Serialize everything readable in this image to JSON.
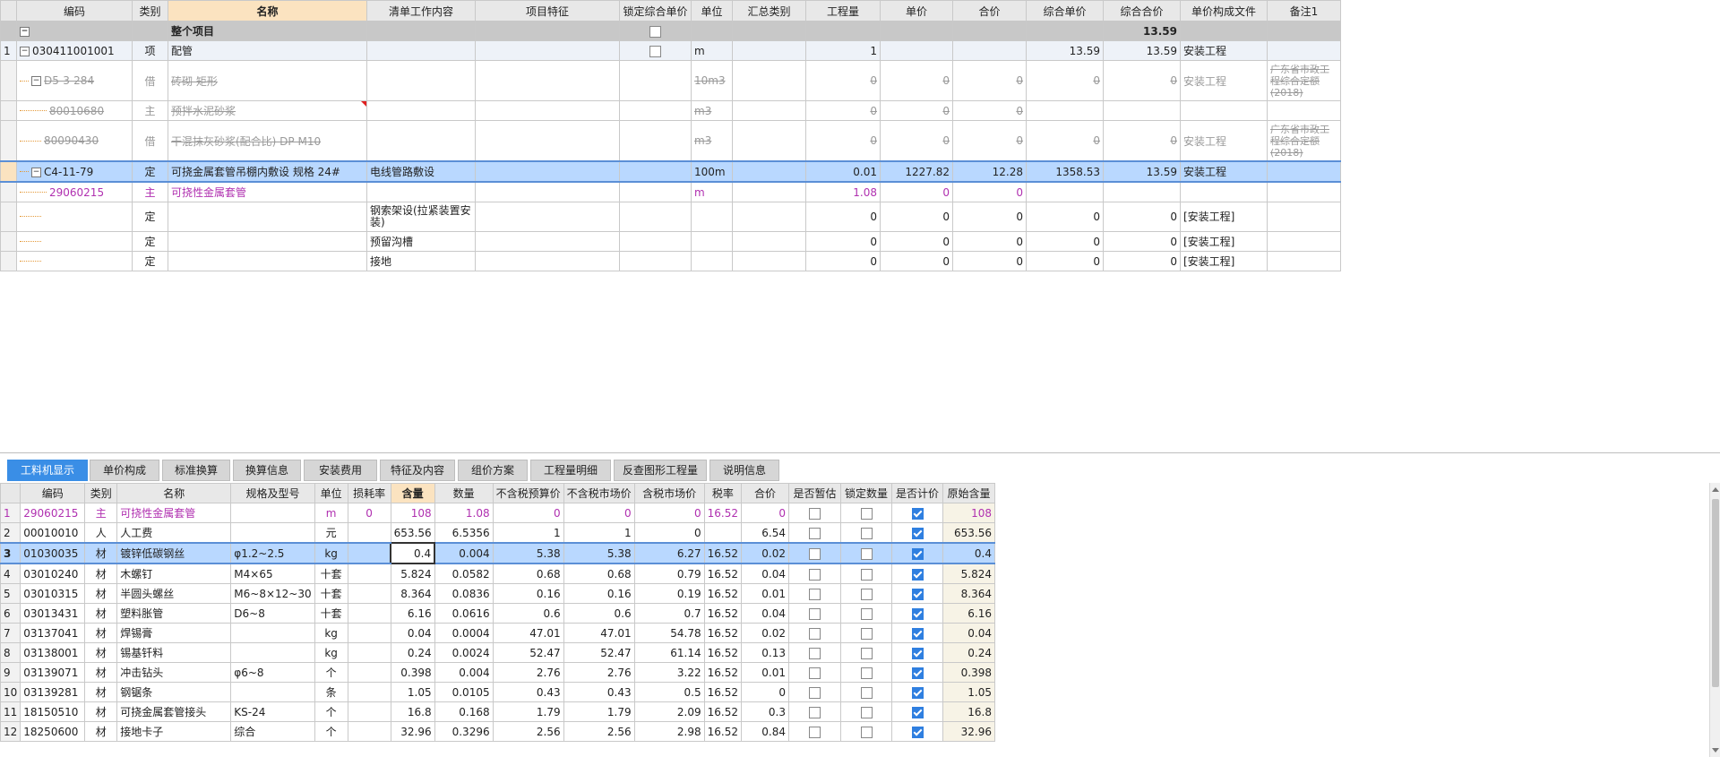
{
  "top": {
    "headers": [
      "编码",
      "类别",
      "名称",
      "清单工作内容",
      "项目特征",
      "锁定综合单价",
      "单位",
      "汇总类别",
      "工程量",
      "单价",
      "合价",
      "综合单价",
      "综合合价",
      "单价构成文件",
      "备注1"
    ],
    "summary": {
      "name": "整个项目",
      "total": "13.59"
    },
    "parent": {
      "no": "1",
      "code": "030411001001",
      "type": "项",
      "name": "配管",
      "unit": "m",
      "qty": "1",
      "unit_total": "13.59",
      "total": "13.59",
      "file": "安装工程"
    },
    "faded": [
      {
        "code": "D5-3-284",
        "type": "借",
        "name": "砖砌 矩形",
        "unit": "10m3",
        "qty": "0",
        "price": "0",
        "amount": "0",
        "unit_total": "0",
        "total": "0",
        "file": "安装工程",
        "remark": "广东省市政工程综合定额(2018)"
      },
      {
        "code": "80010680",
        "type": "主",
        "name": "预拌水泥砂浆",
        "unit": "m3",
        "qty": "0",
        "price": "0",
        "amount": "0",
        "unit_total": "",
        "total": "",
        "file": "",
        "remark": ""
      },
      {
        "code": "80090430",
        "type": "借",
        "name": "干混抹灰砂浆(配合比) DP M10",
        "unit": "m3",
        "qty": "0",
        "price": "0",
        "amount": "0",
        "unit_total": "0",
        "total": "0",
        "file": "安装工程",
        "remark": "广东省市政工程综合定额(2018)"
      }
    ],
    "selected": {
      "code": "C4-11-79",
      "type": "定",
      "name": "可挠金属套管吊棚内敷设 规格 24#",
      "work": "电线管路敷设",
      "unit": "100m",
      "qty": "0.01",
      "price": "1227.82",
      "amount": "12.28",
      "unit_total": "1358.53",
      "total": "13.59",
      "file": "安装工程"
    },
    "main_material": {
      "code": "29060215",
      "type": "主",
      "name": "可挠性金属套管",
      "unit": "m",
      "qty": "1.08",
      "price": "0",
      "amount": "0"
    },
    "subs": [
      {
        "type": "定",
        "work": "钢索架设(拉紧装置安装)",
        "qty": "0",
        "price": "0",
        "amount": "0",
        "unit_total": "0",
        "total": "0",
        "file": "[安装工程]"
      },
      {
        "type": "定",
        "work": "预留沟槽",
        "qty": "0",
        "price": "0",
        "amount": "0",
        "unit_total": "0",
        "total": "0",
        "file": "[安装工程]"
      },
      {
        "type": "定",
        "work": "接地",
        "qty": "0",
        "price": "0",
        "amount": "0",
        "unit_total": "0",
        "total": "0",
        "file": "[安装工程]"
      }
    ]
  },
  "tabs": [
    "工料机显示",
    "单价构成",
    "标准换算",
    "换算信息",
    "安装费用",
    "特征及内容",
    "组价方案",
    "工程量明细",
    "反查图形工程量",
    "说明信息"
  ],
  "bottom": {
    "headers": [
      "编码",
      "类别",
      "名称",
      "规格及型号",
      "单位",
      "损耗率",
      "含量",
      "数量",
      "不含税预算价",
      "不含税市场价",
      "含税市场价",
      "税率",
      "合价",
      "是否暂估",
      "锁定数量",
      "是否计价",
      "原始含量"
    ],
    "rows": [
      {
        "no": "1",
        "code": "29060215",
        "type": "主",
        "name": "可挠性金属套管",
        "spec": "",
        "unit": "m",
        "loss": "0",
        "content": "108",
        "qty": "1.08",
        "pre": "0",
        "mkt": "0",
        "mkt_tax": "0",
        "tax": "16.52",
        "amount": "0",
        "orig": "108"
      },
      {
        "no": "2",
        "code": "00010010",
        "type": "人",
        "name": "人工费",
        "spec": "",
        "unit": "元",
        "loss": "",
        "content": "653.56",
        "qty": "6.5356",
        "pre": "1",
        "mkt": "1",
        "mkt_tax": "0",
        "tax": "",
        "amount": "6.54",
        "orig": "653.56"
      },
      {
        "no": "3",
        "code": "01030035",
        "type": "材",
        "name": "镀锌低碳钢丝",
        "spec": "φ1.2~2.5",
        "unit": "kg",
        "loss": "",
        "content": "0.4",
        "qty": "0.004",
        "pre": "5.38",
        "mkt": "5.38",
        "mkt_tax": "6.27",
        "tax": "16.52",
        "amount": "0.02",
        "orig": "0.4"
      },
      {
        "no": "4",
        "code": "03010240",
        "type": "材",
        "name": "木螺钉",
        "spec": "M4×65",
        "unit": "十套",
        "loss": "",
        "content": "5.824",
        "qty": "0.0582",
        "pre": "0.68",
        "mkt": "0.68",
        "mkt_tax": "0.79",
        "tax": "16.52",
        "amount": "0.04",
        "orig": "5.824"
      },
      {
        "no": "5",
        "code": "03010315",
        "type": "材",
        "name": "半圆头螺丝",
        "spec": "M6~8×12~30",
        "unit": "十套",
        "loss": "",
        "content": "8.364",
        "qty": "0.0836",
        "pre": "0.16",
        "mkt": "0.16",
        "mkt_tax": "0.19",
        "tax": "16.52",
        "amount": "0.01",
        "orig": "8.364"
      },
      {
        "no": "6",
        "code": "03013431",
        "type": "材",
        "name": "塑料胀管",
        "spec": "D6~8",
        "unit": "十套",
        "loss": "",
        "content": "6.16",
        "qty": "0.0616",
        "pre": "0.6",
        "mkt": "0.6",
        "mkt_tax": "0.7",
        "tax": "16.52",
        "amount": "0.04",
        "orig": "6.16"
      },
      {
        "no": "7",
        "code": "03137041",
        "type": "材",
        "name": "焊锡膏",
        "spec": "",
        "unit": "kg",
        "loss": "",
        "content": "0.04",
        "qty": "0.0004",
        "pre": "47.01",
        "mkt": "47.01",
        "mkt_tax": "54.78",
        "tax": "16.52",
        "amount": "0.02",
        "orig": "0.04"
      },
      {
        "no": "8",
        "code": "03138001",
        "type": "材",
        "name": "锡基钎料",
        "spec": "",
        "unit": "kg",
        "loss": "",
        "content": "0.24",
        "qty": "0.0024",
        "pre": "52.47",
        "mkt": "52.47",
        "mkt_tax": "61.14",
        "tax": "16.52",
        "amount": "0.13",
        "orig": "0.24"
      },
      {
        "no": "9",
        "code": "03139071",
        "type": "材",
        "name": "冲击钻头",
        "spec": "φ6~8",
        "unit": "个",
        "loss": "",
        "content": "0.398",
        "qty": "0.004",
        "pre": "2.76",
        "mkt": "2.76",
        "mkt_tax": "3.22",
        "tax": "16.52",
        "amount": "0.01",
        "orig": "0.398"
      },
      {
        "no": "10",
        "code": "03139281",
        "type": "材",
        "name": "钢锯条",
        "spec": "",
        "unit": "条",
        "loss": "",
        "content": "1.05",
        "qty": "0.0105",
        "pre": "0.43",
        "mkt": "0.43",
        "mkt_tax": "0.5",
        "tax": "16.52",
        "amount": "0",
        "orig": "1.05"
      },
      {
        "no": "11",
        "code": "18150510",
        "type": "材",
        "name": "可挠金属套管接头",
        "spec": "KS-24",
        "unit": "个",
        "loss": "",
        "content": "16.8",
        "qty": "0.168",
        "pre": "1.79",
        "mkt": "1.79",
        "mkt_tax": "2.09",
        "tax": "16.52",
        "amount": "0.3",
        "orig": "16.8"
      },
      {
        "no": "12",
        "code": "18250600",
        "type": "材",
        "name": "接地卡子",
        "spec": "综合",
        "unit": "个",
        "loss": "",
        "content": "32.96",
        "qty": "0.3296",
        "pre": "2.56",
        "mkt": "2.56",
        "mkt_tax": "2.98",
        "tax": "16.52",
        "amount": "0.84",
        "orig": "32.96"
      }
    ]
  }
}
